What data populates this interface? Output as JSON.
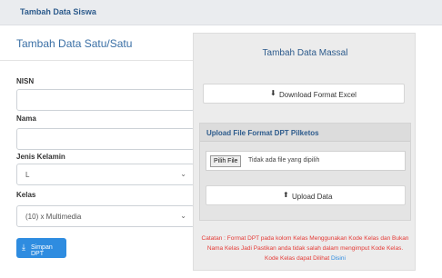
{
  "header": {
    "title": "Tambah Data Siswa"
  },
  "single": {
    "heading": "Tambah Data Satu/Satu",
    "nisn_label": "NISN",
    "nisn_value": "",
    "nama_label": "Nama",
    "nama_value": "",
    "gender_label": "Jenis Kelamin",
    "gender_value": "L",
    "kelas_label": "Kelas",
    "kelas_value": "(10) x Multimedia",
    "save_label": "Simpan DPT"
  },
  "mass": {
    "heading": "Tambah Data Massal",
    "download_label": "Download Format Excel",
    "upload_panel_title": "Upload File Format DPT Pilketos",
    "choose_file_label": "Pilih File",
    "no_file_text": "Tidak ada file yang dipilih",
    "upload_label": "Upload Data",
    "note_text": "Catatan : Format DPT pada kolom Kelas Menggunakan Kode Kelas dan Bukan Nama Kelas Jadi Pastikan anda tidak salah dalam mengimput Kode Kelas. Kode Kelas dapat Dilihat",
    "note_link": "Disini"
  },
  "colors": {
    "primary": "#2e8ce0",
    "heading_blue": "#2d5b8c",
    "note_red": "#e53935"
  },
  "icons": {
    "download": "download-icon",
    "upload": "upload-icon",
    "save": "save-icon",
    "chevron": "chevron-down-icon"
  }
}
